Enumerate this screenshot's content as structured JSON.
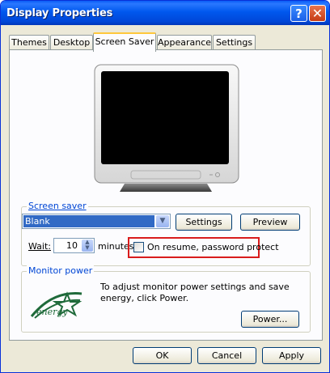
{
  "window": {
    "title": "Display Properties",
    "help_glyph": "?",
    "close_glyph": "✕"
  },
  "tabs": [
    {
      "label": "Themes"
    },
    {
      "label": "Desktop"
    },
    {
      "label": "Screen Saver"
    },
    {
      "label": "Appearance"
    },
    {
      "label": "Settings"
    }
  ],
  "screen_saver": {
    "group_label": "Screen saver",
    "selected": "Blank",
    "settings_label": "Settings",
    "preview_label": "Preview",
    "wait_label": "Wait:",
    "wait_value": "10",
    "minutes_label": "minutes",
    "password_label": "On resume, password protect",
    "password_checked": false
  },
  "monitor_power": {
    "group_label": "Monitor power",
    "description": "To adjust monitor power settings and save energy, click Power.",
    "power_label": "Power...",
    "logo_text": "energy"
  },
  "footer": {
    "ok_label": "OK",
    "cancel_label": "Cancel",
    "apply_label": "Apply"
  }
}
